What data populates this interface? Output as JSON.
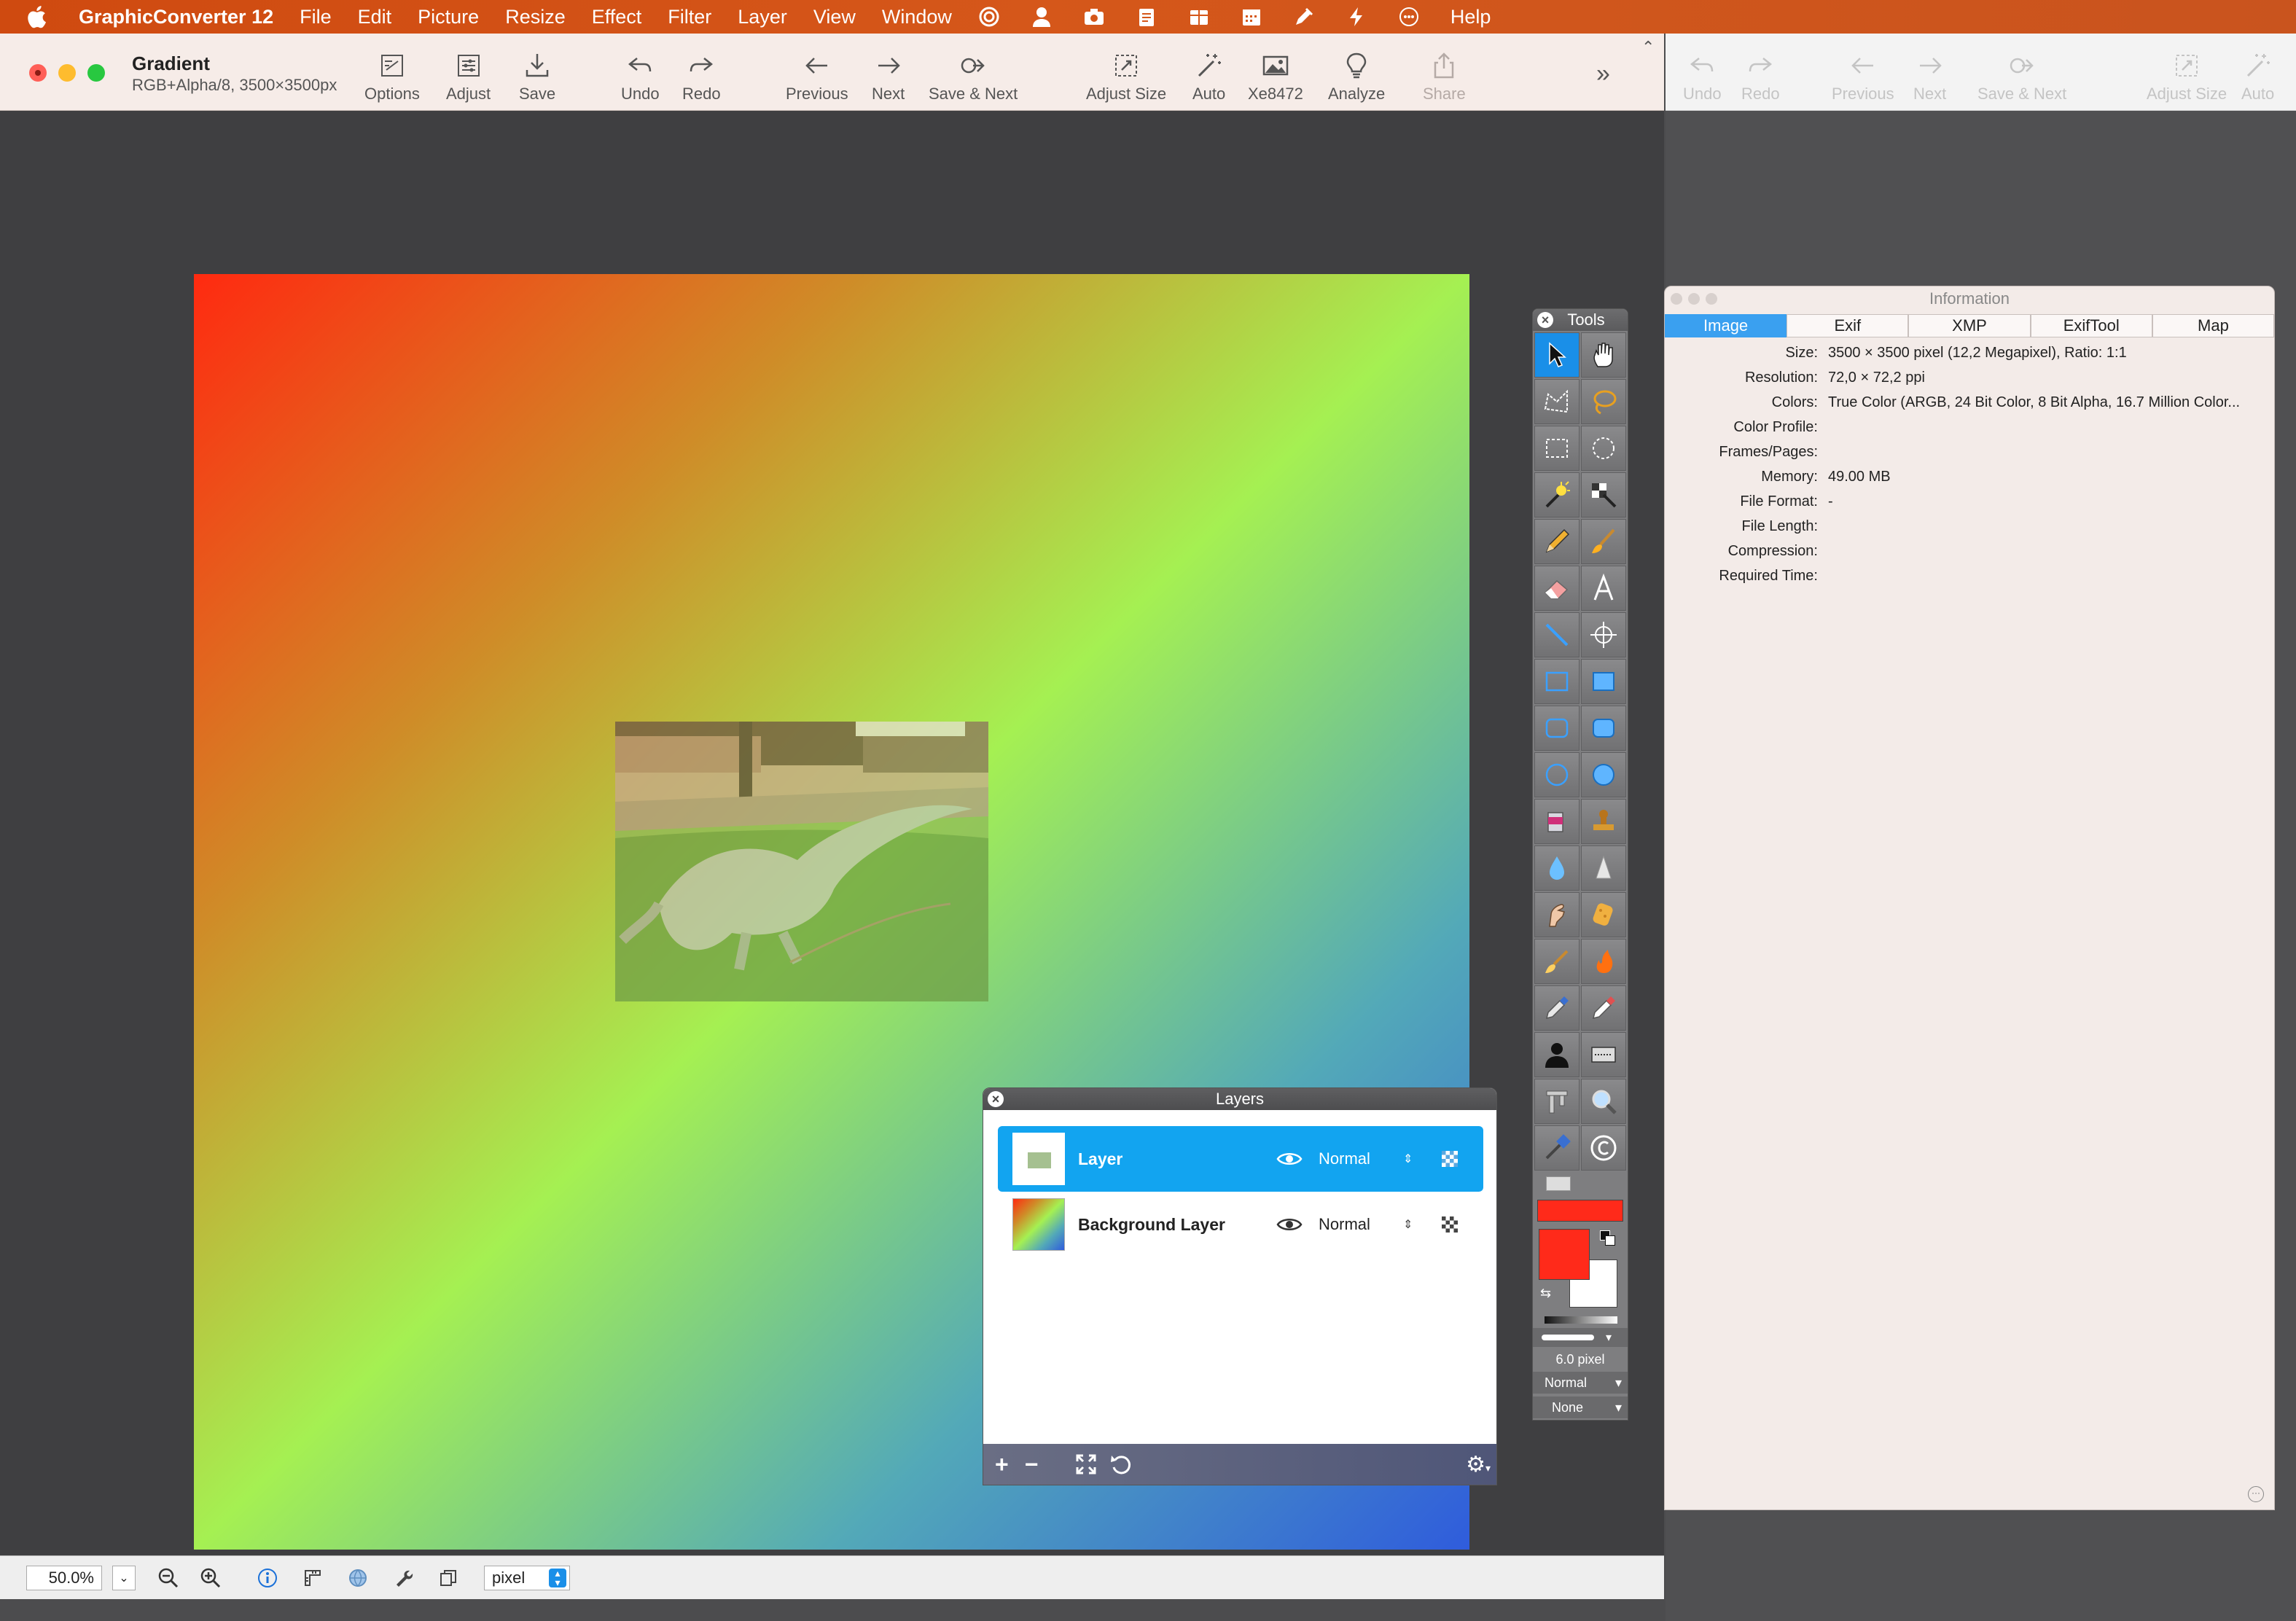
{
  "menubar": {
    "app_name": "GraphicConverter 12",
    "items": [
      "File",
      "Edit",
      "Picture",
      "Resize",
      "Effect",
      "Filter",
      "Layer",
      "View",
      "Window",
      "Help"
    ]
  },
  "document": {
    "title": "Gradient",
    "subtitle": "RGB+Alpha/8, 3500×3500px"
  },
  "toolbar": {
    "options": "Options",
    "adjust": "Adjust",
    "save": "Save",
    "undo": "Undo",
    "redo": "Redo",
    "previous": "Previous",
    "next": "Next",
    "save_next": "Save & Next",
    "adjust_size": "Adjust Size",
    "auto": "Auto",
    "xe": "Xe8472",
    "analyze": "Analyze",
    "share": "Share"
  },
  "bg_toolbar": {
    "undo": "Undo",
    "redo": "Redo",
    "previous": "Previous",
    "next": "Next",
    "save_next": "Save & Next",
    "adjust_size": "Adjust Size",
    "auto": "Auto"
  },
  "tools_panel": {
    "title": "Tools",
    "stroke_width": "6.0 pixel",
    "blend_mode": "Normal",
    "extra": "None",
    "foreground_color": "#ff2a1a",
    "background_color": "#ffffff"
  },
  "layers_panel": {
    "title": "Layers",
    "layers": [
      {
        "name": "Layer",
        "mode": "Normal",
        "selected": true
      },
      {
        "name": "Background Layer",
        "mode": "Normal",
        "selected": false
      }
    ]
  },
  "info_panel": {
    "title": "Information",
    "tabs": [
      "Image",
      "Exif",
      "XMP",
      "ExifTool",
      "Map"
    ],
    "rows": [
      {
        "key": "Size:",
        "value": "3500 × 3500 pixel (12,2 Megapixel), Ratio: 1:1"
      },
      {
        "key": "Resolution:",
        "value": "72,0 × 72,2 ppi"
      },
      {
        "key": "Colors:",
        "value": "True Color (ARGB, 24 Bit Color, 8 Bit Alpha, 16.7 Million Color..."
      },
      {
        "key": "Color Profile:",
        "value": ""
      },
      {
        "key": "Frames/Pages:",
        "value": ""
      },
      {
        "key": "Memory:",
        "value": "49.00 MB"
      },
      {
        "key": "File Format:",
        "value": "-"
      },
      {
        "key": "File Length:",
        "value": ""
      },
      {
        "key": "Compression:",
        "value": ""
      },
      {
        "key": "Required Time:",
        "value": ""
      }
    ]
  },
  "statusbar": {
    "zoom": "50.0%",
    "unit": "pixel"
  },
  "colors": {
    "menubar": "#d5571a",
    "accent": "#12a4f0",
    "close": "#ff5f57",
    "minimize": "#febc2e",
    "zoom": "#28c840"
  }
}
